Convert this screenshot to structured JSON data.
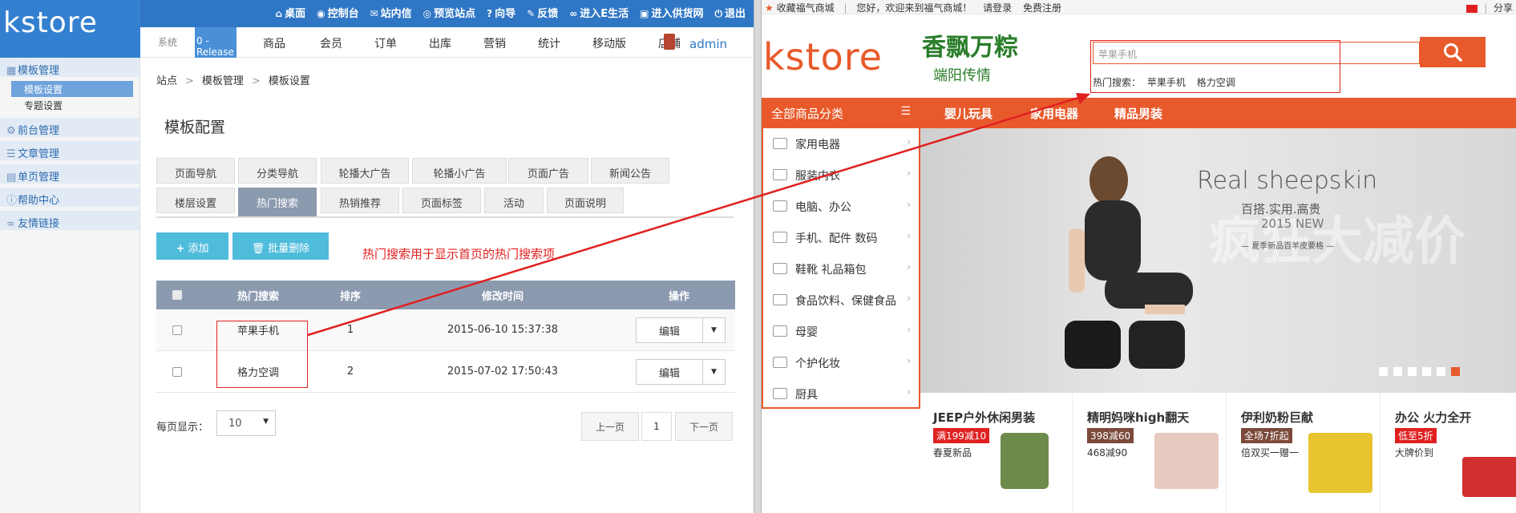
{
  "admin": {
    "logo": "kstore",
    "toplinks": [
      {
        "icon": "home-icon",
        "glyph": "⌂",
        "label": "桌面"
      },
      {
        "icon": "dashboard-icon",
        "glyph": "◉",
        "label": "控制台"
      },
      {
        "icon": "mail-icon",
        "glyph": "✉",
        "label": "站内信"
      },
      {
        "icon": "eye-icon",
        "glyph": "◎",
        "label": "预览站点"
      },
      {
        "icon": "help-icon",
        "glyph": "?",
        "label": "向导"
      },
      {
        "icon": "edit-icon",
        "glyph": "✎",
        "label": "反馈"
      },
      {
        "icon": "link-icon",
        "glyph": "∞",
        "label": "进入E生活"
      },
      {
        "icon": "lock-icon",
        "glyph": "▣",
        "label": "进入供货网"
      },
      {
        "icon": "power-icon",
        "glyph": "⏻",
        "label": "退出"
      }
    ],
    "nav": {
      "overlap_text": "0 - Release",
      "items": [
        "系统",
        "商品",
        "会员",
        "订单",
        "出库",
        "营销",
        "统计",
        "移动版",
        "店铺"
      ],
      "user": "admin"
    },
    "sidebar": {
      "groups": [
        {
          "label": "模板管理",
          "icon": "grid-icon",
          "glyph": "▦",
          "subs": [
            {
              "label": "模板设置",
              "active": true
            },
            {
              "label": "专题设置",
              "active": false
            }
          ]
        },
        {
          "label": "前台管理",
          "icon": "gear-icon",
          "glyph": "⚙",
          "subs": []
        },
        {
          "label": "文章管理",
          "icon": "list-icon",
          "glyph": "☰",
          "subs": []
        },
        {
          "label": "单页管理",
          "icon": "page-icon",
          "glyph": "▤",
          "subs": []
        },
        {
          "label": "帮助中心",
          "icon": "info-icon",
          "glyph": "ⓘ",
          "subs": []
        },
        {
          "label": "友情链接",
          "icon": "link-icon",
          "glyph": "∞",
          "subs": []
        }
      ]
    },
    "breadcrumb": [
      "站点",
      "模板管理",
      "模板设置"
    ],
    "breadcrumb_sep": ">",
    "page_title": "模板配置",
    "tabs_row1": [
      "页面导航",
      "分类导航",
      "轮播大广告",
      "轮播小广告",
      "页面广告",
      "新闻公告"
    ],
    "tabs_row2": [
      "楼层设置",
      "热门搜索",
      "热销推荐",
      "页面标签",
      "活动",
      "页面说明"
    ],
    "active_tab": "热门搜索",
    "add_label": "添加",
    "batch_delete_label": "批量删除",
    "hint": "热门搜索用于显示首页的热门搜索项",
    "table": {
      "headers": [
        "热门搜索",
        "排序",
        "修改时间",
        "操作"
      ],
      "rows": [
        {
          "keyword": "苹果手机",
          "sort": "1",
          "time": "2015-06-10 15:37:38",
          "action": "编辑"
        },
        {
          "keyword": "格力空调",
          "sort": "2",
          "time": "2015-07-02 17:50:43",
          "action": "编辑"
        }
      ]
    },
    "per_page_label": "每页显示：",
    "per_page_value": "10",
    "pagination": {
      "prev": "上一页",
      "current": "1",
      "next": "下一页"
    }
  },
  "store": {
    "topbar": {
      "favorite": "收藏福气商城",
      "divider": "|",
      "welcome": "您好，欢迎来到福气商城！",
      "login": "请登录",
      "register": "免费注册",
      "share": "分享"
    },
    "logo": "kstore",
    "promo_title": "香飘万粽",
    "promo_sub": "端阳传情",
    "search_placeholder": "苹果手机",
    "hot_search_label": "热门搜索：",
    "hot_search_items": [
      "苹果手机",
      "格力空调"
    ],
    "nav_all": "全部商品分类",
    "nav_items": [
      "婴儿玩具",
      "家用电器",
      "精品男装"
    ],
    "categories": [
      "家用电器",
      "服装内衣",
      "电脑、办公",
      "手机、配件  数码",
      "鞋靴  礼品箱包",
      "食品饮料、保健食品",
      "母婴",
      "个护化妆",
      "厨具"
    ],
    "banner": {
      "title": "Real sheepskin",
      "cn": "百搭.实用.高贵",
      "new": "2015 NEW",
      "sub": "— 夏季新品百羊皮要格 —",
      "watermark": "疯狂大减价",
      "dots_count": 6,
      "active_dot": 5
    },
    "promos": [
      {
        "title": "JEEP户外休闲男装",
        "tag": "满199减10",
        "tag_color": "#e02020",
        "sub": "春夏新品"
      },
      {
        "title": "精明妈咪high翻天",
        "tag": "398减60",
        "tag_color": "#7b4a3a",
        "sub": "468减90"
      },
      {
        "title": "伊利奶粉巨献",
        "tag": "全场7折起",
        "tag_color": "#7b4a3a",
        "sub": "倍双买一赠一"
      },
      {
        "title": "办公 火力全开",
        "tag": "低至5折",
        "tag_color": "#e02020",
        "sub": "大牌价到"
      }
    ],
    "colors": {
      "accent": "#e85a2b",
      "admin_blue": "#2f77c5",
      "annotation_red": "#e02020"
    }
  }
}
